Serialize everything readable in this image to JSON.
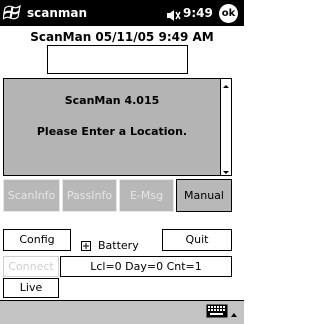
{
  "titlebar": {
    "app_title": "scanman",
    "clock": "9:49",
    "ok_label": "ok"
  },
  "header": {
    "datetime": "ScanMan 05/11/05 9:49 AM"
  },
  "location_input": {
    "value": ""
  },
  "message": {
    "version": "ScanMan 4.015",
    "text": "Please Enter a Location."
  },
  "buttons": {
    "scaninfo": "ScanInfo",
    "passinfo": "PassInfo",
    "emsg": "E-Msg",
    "manual": "Manual",
    "config": "Config",
    "quit": "Quit",
    "connect": "Connect",
    "live": "Live"
  },
  "battery": {
    "label": "Battery"
  },
  "status": {
    "text": "Lcl=0 Day=0 Cnt=1"
  },
  "icons": {
    "start": "windows-flag-icon",
    "speaker": "speaker-icon",
    "keyboard": "keyboard-icon",
    "battery_expand": "plus-box-icon"
  }
}
